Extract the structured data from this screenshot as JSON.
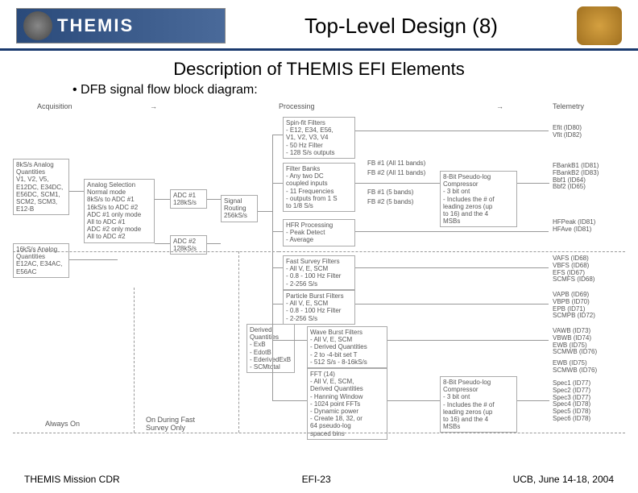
{
  "header": {
    "logo": "THEMIS",
    "title": "Top-Level Design (8)"
  },
  "subtitle": "Description of THEMIS EFI Elements",
  "bullet": "• DFB signal flow block diagram:",
  "sections": {
    "acq": "Acquisition",
    "proc": "Processing",
    "tel": "Telemetry"
  },
  "boxes": {
    "b1": "8kS/s Analog\nQuantities\nV1, V2, V5,\nE12DC, E34DC,\nE56DC, SCM1,\nSCM2, SCM3,\nE12-B",
    "b2": "16kS/s Analog\nQuantities\nE12AC, E34AC,\nE56AC",
    "b3": "Analog Selection\nNormal mode\n8kS/s to ADC #1\n16kS/s to ADC #2\nADC #1 only mode\nAll to ADC #1\nADC #2 only mode\nAll to ADC #2",
    "b4": "ADC #1\n128kS/s",
    "b5": "ADC #2\n128kS/s",
    "b6": "Signal\nRouting\n256kS/s",
    "b7": "Spin-fit Filters\n- E12, E34, E56,\nV1, V2, V3, V4\n- 50 Hz Filter\n- 128 S/s outputs",
    "b8": "Filter Banks\n- Any two DC\ncoupled inputs\n- 11 Frequencies\n- outputs from 1 S\nto 1/8 S/s",
    "b9": "HFR Processing\n- Peak Detect\n- Average",
    "b10": "Fast Survey Filters\n- All V, E, SCM\n- 0.8 - 100 Hz Filter\n- 2-256 S/s",
    "b11": "Particle Burst Filters\n- All V, E, SCM\n- 0.8 - 100 Hz Filter\n- 2-256 S/s",
    "b12": "Derived\nQuantities\n- ExB\n- EdotB\n- EderivedExB\n- SCMtotal",
    "b13": "Wave Burst Filters\n- All V, E, SCM\n- Derived Quantities\n- 2 to -4-bit set T\n- 512 S/s - 8-16kS/s",
    "b14": "FFT (14)\n- All V, E, SCM,\nDerived Quantities\n- Hanning Window\n- 1024 point FFTs\n- Dynamic power\n- Create 18, 32, or\n64 pseudo-log\nspaced bins",
    "c1": "8-Bit Pseudo-log\nCompressor\n- 3 bit ont\n- Includes the # of\nleading zeros (up\nto 16) and the 4\nMSBs",
    "c2": "8-Bit Pseudo-log\nCompressor\n- 3 bit ont\n- Includes the # of\nleading zeros (up\nto 16) and the 4\nMSBs"
  },
  "labels": {
    "l1": "Efit (ID80)\nVfit (ID82)",
    "l2": "FB #1 (All 11 bands)",
    "l3": "FB #2 (All 11 bands)",
    "l4": "FB #1 (5 bands)",
    "l5": "FB #2 (5 bands)",
    "l6": "FBankB1 (ID81)\nFBankB2 (ID83)\nBbf1 (ID64)\nBbf2 (ID65)",
    "l7": "HFPeak (ID81)\nHFAve (ID81)",
    "l8": "VAFS (ID68)\nVBFS (ID68)\nEFS (ID67)\nSCMFS (ID68)",
    "l9": "VAPB (ID69)\nVBPB (ID70)\nEPB (ID71)\nSCMPB (ID72)",
    "l10": "VAWB (ID73)\nVBWB (ID74)\nEWB (ID75)\nSCMWB (ID76)",
    "l11": "EWB (ID75)\nSCMWB (ID76)",
    "l12": "Spec1 (ID77)\nSpec2 (ID77)\nSpec3 (ID77)\nSpec4 (ID78)\nSpec5 (ID78)\nSpec6 (ID78)"
  },
  "bottom": {
    "a": "Always On",
    "b": "On During Fast\nSurvey Only"
  },
  "footer": {
    "left": "THEMIS Mission CDR",
    "mid": "EFI-23",
    "right": "UCB, June 14-18, 2004"
  }
}
